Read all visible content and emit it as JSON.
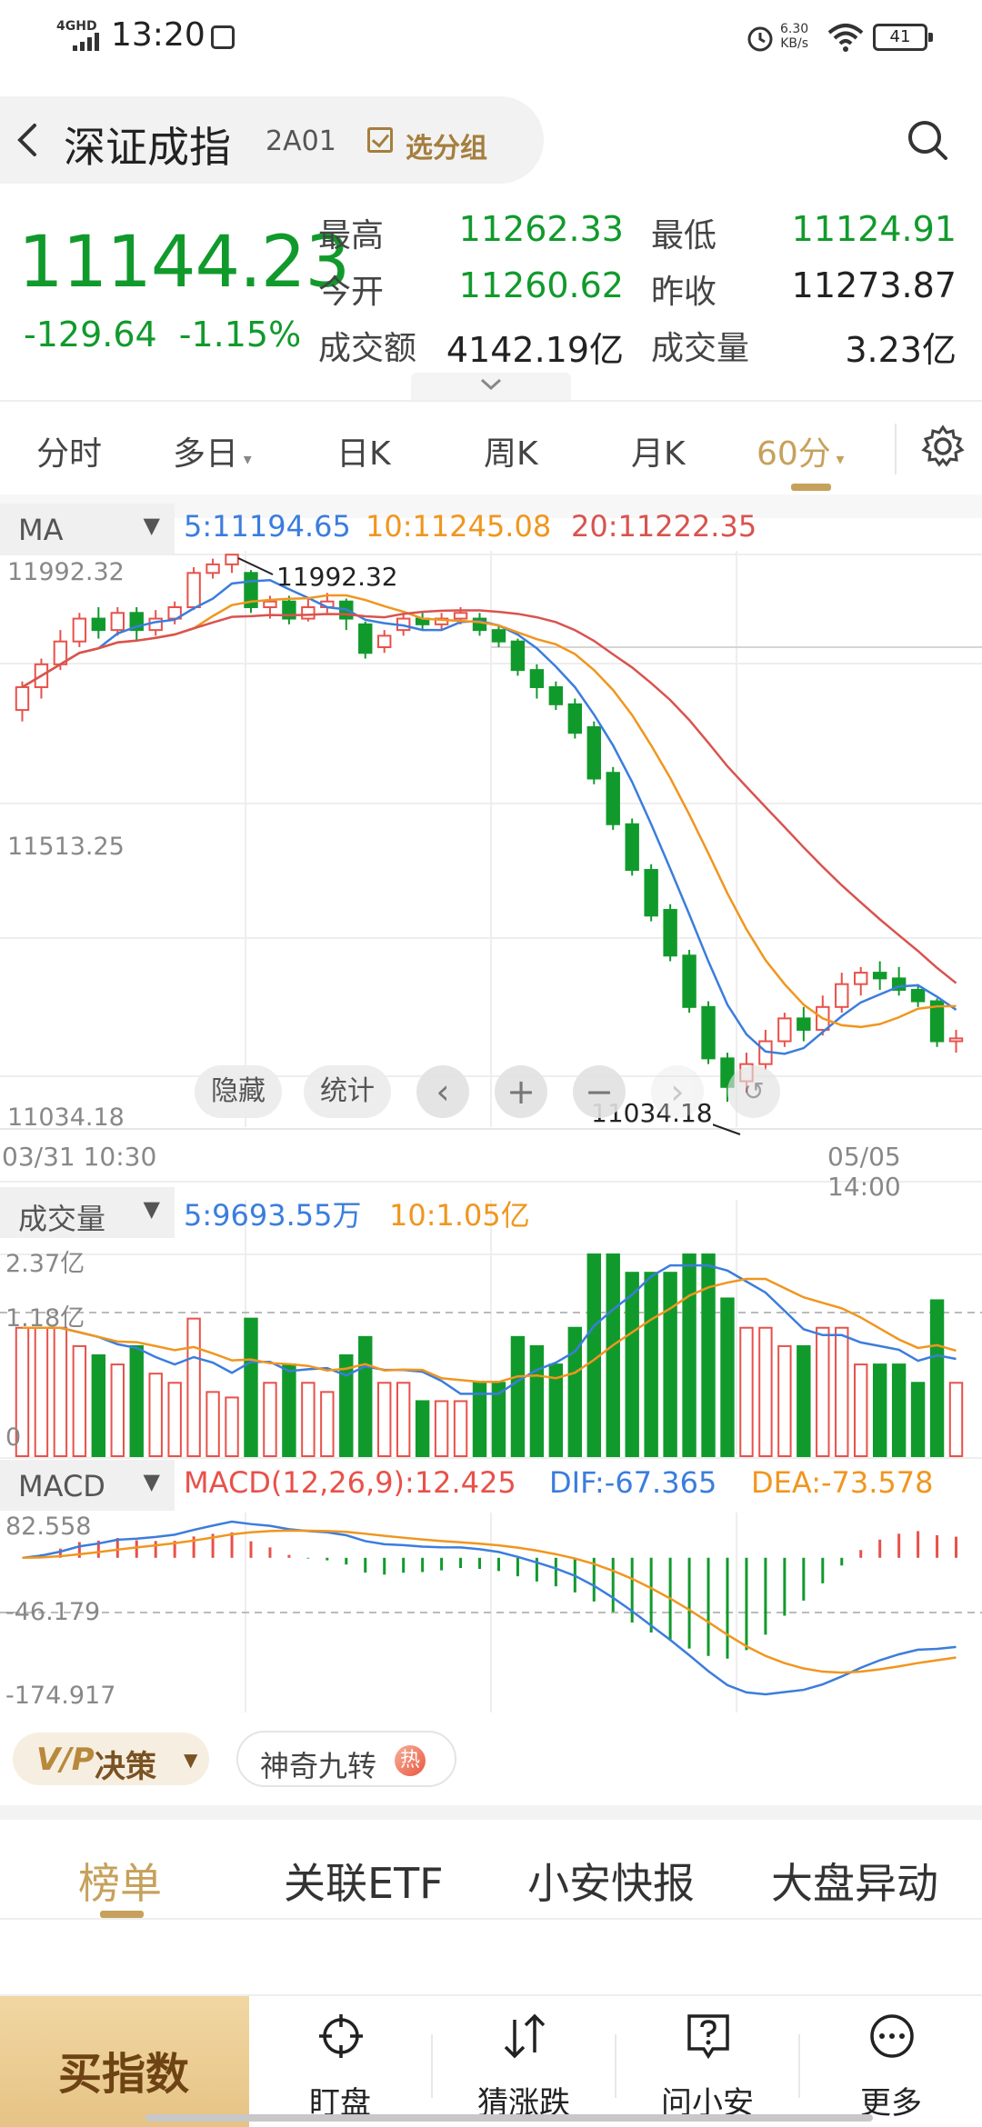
{
  "status_bar": {
    "network": "4GHD",
    "time": "13:20",
    "speed_value": "6.30",
    "speed_unit": "KB/s",
    "battery": "41"
  },
  "header": {
    "title": "深证成指",
    "code": "2A01",
    "group_label": "选分组"
  },
  "quote": {
    "price": "11144.23",
    "change": "-129.64",
    "change_pct": "-1.15%",
    "high_label": "最高",
    "high": "11262.33",
    "low_label": "最低",
    "low": "11124.91",
    "open_label": "今开",
    "open": "11260.62",
    "prev_close_label": "昨收",
    "prev_close": "11273.87",
    "turnover_label": "成交额",
    "turnover": "4142.19亿",
    "volume_label": "成交量",
    "volume": "3.23亿"
  },
  "period_tabs": [
    "分时",
    "多日",
    "日K",
    "周K",
    "月K",
    "60分"
  ],
  "active_period": "60分",
  "ma": {
    "name": "MA",
    "ma5": "5:11194.65",
    "ma10": "10:11245.08",
    "ma20": "20:11222.35"
  },
  "chart_controls": {
    "hide": "隐藏",
    "stats": "统计"
  },
  "vol_indicator": {
    "name": "成交量",
    "ma5": "5:9693.55万",
    "ma10": "10:1.05亿"
  },
  "macd_indicator": {
    "name": "MACD",
    "macd": "MACD(12,26,9):12.425",
    "dif": "DIF:-67.365",
    "dea": "DEA:-73.578"
  },
  "colors": {
    "up": "#e8514a",
    "down": "#119a2c",
    "ma5": "#3b7ddd",
    "ma10": "#f0961f",
    "ma20": "#d9534f",
    "accent": "#c6a15b"
  },
  "chart_data": {
    "type": "candlestick",
    "price_axis": {
      "max": "11992.32",
      "mid": "11513.25",
      "min": "11034.18",
      "ylim": [
        11034.18,
        11992.32
      ]
    },
    "annotations": {
      "high_mark": "11992.32",
      "low_mark": "11034.18"
    },
    "x_labels": {
      "start": "03/31 10:30",
      "end": "05/05 14:00"
    },
    "candles_approx": [
      {
        "o": 11720,
        "c": 11760,
        "h": 11770,
        "l": 11700
      },
      {
        "o": 11760,
        "c": 11800,
        "h": 11810,
        "l": 11740
      },
      {
        "o": 11800,
        "c": 11840,
        "h": 11860,
        "l": 11790
      },
      {
        "o": 11840,
        "c": 11880,
        "h": 11890,
        "l": 11830
      },
      {
        "o": 11880,
        "c": 11860,
        "h": 11900,
        "l": 11845
      },
      {
        "o": 11860,
        "c": 11890,
        "h": 11900,
        "l": 11850
      },
      {
        "o": 11890,
        "c": 11860,
        "h": 11900,
        "l": 11840
      },
      {
        "o": 11860,
        "c": 11880,
        "h": 11895,
        "l": 11850
      },
      {
        "o": 11880,
        "c": 11900,
        "h": 11910,
        "l": 11870
      },
      {
        "o": 11900,
        "c": 11960,
        "h": 11970,
        "l": 11895
      },
      {
        "o": 11960,
        "c": 11975,
        "h": 11985,
        "l": 11950
      },
      {
        "o": 11975,
        "c": 11992,
        "h": 11992,
        "l": 11960
      },
      {
        "o": 11960,
        "c": 11900,
        "h": 11965,
        "l": 11890
      },
      {
        "o": 11900,
        "c": 11910,
        "h": 11920,
        "l": 11880
      },
      {
        "o": 11910,
        "c": 11880,
        "h": 11920,
        "l": 11870
      },
      {
        "o": 11880,
        "c": 11900,
        "h": 11915,
        "l": 11875
      },
      {
        "o": 11900,
        "c": 11910,
        "h": 11925,
        "l": 11890
      },
      {
        "o": 11910,
        "c": 11880,
        "h": 11915,
        "l": 11860
      },
      {
        "o": 11870,
        "c": 11820,
        "h": 11875,
        "l": 11810
      },
      {
        "o": 11830,
        "c": 11850,
        "h": 11860,
        "l": 11820
      },
      {
        "o": 11860,
        "c": 11880,
        "h": 11890,
        "l": 11850
      },
      {
        "o": 11880,
        "c": 11870,
        "h": 11890,
        "l": 11860
      },
      {
        "o": 11870,
        "c": 11880,
        "h": 11890,
        "l": 11860
      },
      {
        "o": 11880,
        "c": 11890,
        "h": 11900,
        "l": 11870
      },
      {
        "o": 11880,
        "c": 11860,
        "h": 11890,
        "l": 11850
      },
      {
        "o": 11860,
        "c": 11840,
        "h": 11870,
        "l": 11830
      },
      {
        "o": 11840,
        "c": 11790,
        "h": 11845,
        "l": 11780
      },
      {
        "o": 11790,
        "c": 11760,
        "h": 11800,
        "l": 11740
      },
      {
        "o": 11760,
        "c": 11730,
        "h": 11770,
        "l": 11720
      },
      {
        "o": 11730,
        "c": 11680,
        "h": 11740,
        "l": 11670
      },
      {
        "o": 11690,
        "c": 11600,
        "h": 11700,
        "l": 11590
      },
      {
        "o": 11610,
        "c": 11520,
        "h": 11620,
        "l": 11510
      },
      {
        "o": 11520,
        "c": 11440,
        "h": 11530,
        "l": 11430
      },
      {
        "o": 11440,
        "c": 11360,
        "h": 11450,
        "l": 11350
      },
      {
        "o": 11370,
        "c": 11290,
        "h": 11380,
        "l": 11280
      },
      {
        "o": 11290,
        "c": 11200,
        "h": 11300,
        "l": 11190
      },
      {
        "o": 11200,
        "c": 11110,
        "h": 11210,
        "l": 11100
      },
      {
        "o": 11110,
        "c": 11060,
        "h": 11120,
        "l": 11034
      },
      {
        "o": 11070,
        "c": 11100,
        "h": 11120,
        "l": 11050
      },
      {
        "o": 11100,
        "c": 11140,
        "h": 11160,
        "l": 11090
      },
      {
        "o": 11140,
        "c": 11180,
        "h": 11190,
        "l": 11130
      },
      {
        "o": 11180,
        "c": 11160,
        "h": 11200,
        "l": 11140
      },
      {
        "o": 11160,
        "c": 11200,
        "h": 11220,
        "l": 11150
      },
      {
        "o": 11200,
        "c": 11240,
        "h": 11260,
        "l": 11190
      },
      {
        "o": 11240,
        "c": 11260,
        "h": 11270,
        "l": 11220
      },
      {
        "o": 11260,
        "c": 11250,
        "h": 11280,
        "l": 11230
      },
      {
        "o": 11250,
        "c": 11230,
        "h": 11270,
        "l": 11220
      },
      {
        "o": 11230,
        "c": 11210,
        "h": 11240,
        "l": 11200
      },
      {
        "o": 11210,
        "c": 11140,
        "h": 11215,
        "l": 11130
      },
      {
        "o": 11140,
        "c": 11145,
        "h": 11160,
        "l": 11120
      }
    ],
    "volume_axis": {
      "max": "2.37亿",
      "mid": "1.18亿",
      "min": "0"
    },
    "macd_axis": {
      "max": "82.558",
      "mid": "-46.179",
      "min": "-174.917"
    }
  },
  "tags": {
    "vip": "决策",
    "nine": "神奇九转",
    "hot": "热"
  },
  "news_tabs": [
    "榜单",
    "关联ETF",
    "小安快报",
    "大盘异动"
  ],
  "bottom_nav": {
    "buy": "买指数",
    "items": [
      "盯盘",
      "猜涨跌",
      "问小安",
      "更多"
    ]
  }
}
